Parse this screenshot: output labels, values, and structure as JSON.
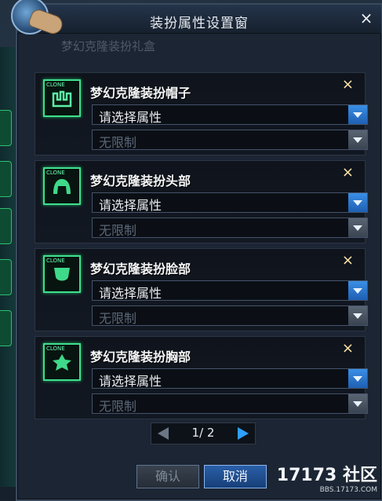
{
  "window": {
    "title": "装扮属性设置窗",
    "ghost_title": "梦幻克隆装扮礼盒"
  },
  "slots": [
    {
      "title": "梦幻克隆装扮帽子",
      "attribute": "请选择属性",
      "limit": "无限制",
      "icon": "hat-icon"
    },
    {
      "title": "梦幻克隆装扮头部",
      "attribute": "请选择属性",
      "limit": "无限制",
      "icon": "hair-icon"
    },
    {
      "title": "梦幻克隆装扮脸部",
      "attribute": "请选择属性",
      "limit": "无限制",
      "icon": "face-icon"
    },
    {
      "title": "梦幻克隆装扮胸部",
      "attribute": "请选择属性",
      "limit": "无限制",
      "icon": "chest-icon"
    }
  ],
  "clone_tag": "CLONE",
  "close_glyph": "×",
  "pager": {
    "current": 1,
    "total": 2,
    "label": "1/ 2"
  },
  "buttons": {
    "confirm": "确认",
    "cancel": "取消"
  },
  "watermark": {
    "main": "17173 社区",
    "sub": "BBS.17173.COM"
  },
  "colors": {
    "accent": "#2ea0ff",
    "icon_border": "#3fe08c",
    "panel_bg": "#121822"
  }
}
